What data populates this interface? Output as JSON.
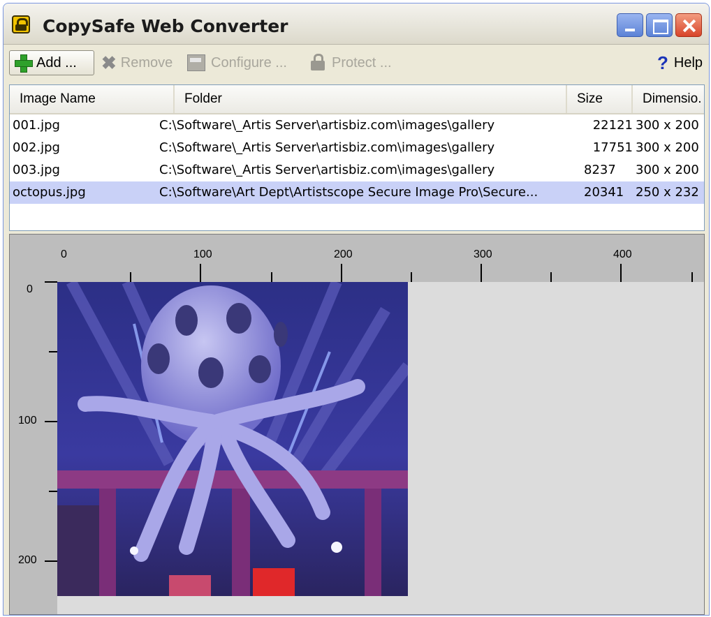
{
  "window": {
    "title": "CopySafe Web Converter"
  },
  "toolbar": {
    "add": "Add ...",
    "remove": "Remove",
    "configure": "Configure ...",
    "protect": "Protect ...",
    "help": "Help",
    "help_glyph": "?"
  },
  "list": {
    "columns": [
      "Image Name",
      "Folder",
      "Size",
      "Dimensio."
    ],
    "rows": [
      {
        "name": "001.jpg",
        "folder": "C:\\Software\\_Artis Server\\artisbiz.com\\images\\gallery",
        "size": "22121",
        "dimensions": "300 x 200"
      },
      {
        "name": "002.jpg",
        "folder": "C:\\Software\\_Artis Server\\artisbiz.com\\images\\gallery",
        "size": "17751",
        "dimensions": "300 x 200"
      },
      {
        "name": "003.jpg",
        "folder": "C:\\Software\\_Artis Server\\artisbiz.com\\images\\gallery",
        "size": "8237",
        "dimensions": "300 x 200"
      },
      {
        "name": "octopus.jpg",
        "folder": "C:\\Software\\Art Dept\\Artistscope Secure Image Pro\\Secure...",
        "size": "20341",
        "dimensions": "250 x 232"
      }
    ],
    "selected_row": "octopus.jpg"
  },
  "preview": {
    "ruler_top_labels": [
      "0",
      "100",
      "200",
      "300",
      "400"
    ],
    "ruler_left_labels": [
      "0",
      "100",
      "200"
    ]
  }
}
